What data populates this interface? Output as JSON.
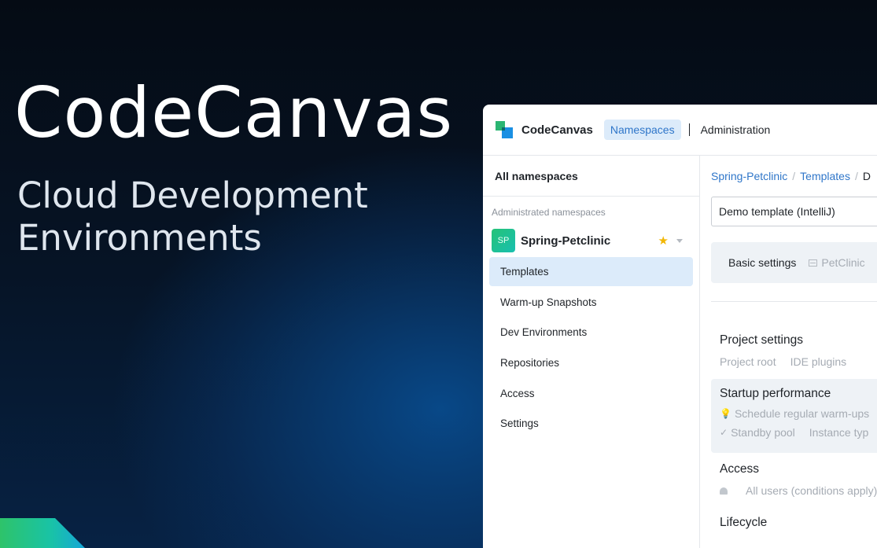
{
  "hero": {
    "title": "CodeCanvas",
    "subtitle_line1": "Cloud Development",
    "subtitle_line2": "Environments"
  },
  "header": {
    "app_name": "CodeCanvas",
    "nav": {
      "namespaces": "Namespaces",
      "administration": "Administration"
    }
  },
  "sidebar": {
    "title": "All namespaces",
    "section_label": "Administrated namespaces",
    "namespace": {
      "avatar": "SP",
      "name": "Spring-Petclinic",
      "starred": true
    },
    "items": [
      {
        "label": "Templates",
        "active": true
      },
      {
        "label": "Warm-up Snapshots"
      },
      {
        "label": "Dev Environments"
      },
      {
        "label": "Repositories"
      },
      {
        "label": "Access"
      },
      {
        "label": "Settings"
      }
    ]
  },
  "main": {
    "breadcrumbs": [
      "Spring-Petclinic",
      "Templates",
      "D"
    ],
    "template_select": "Demo template (IntelliJ)",
    "tabs": {
      "basic": "Basic settings",
      "petclinic": "PetClinic"
    },
    "project_settings": {
      "title": "Project settings",
      "items": [
        "Project root",
        "IDE plugins"
      ]
    },
    "startup_performance": {
      "title": "Startup performance",
      "warmups": "Schedule regular warm-ups",
      "standby": "Standby pool",
      "instance": "Instance typ"
    },
    "access": {
      "title": "Access",
      "users": "All users (conditions apply)"
    },
    "lifecycle": {
      "title": "Lifecycle"
    }
  },
  "colors": {
    "accent": "#2f76c9",
    "highlight": "#dcebfa",
    "star": "#f2b705"
  }
}
